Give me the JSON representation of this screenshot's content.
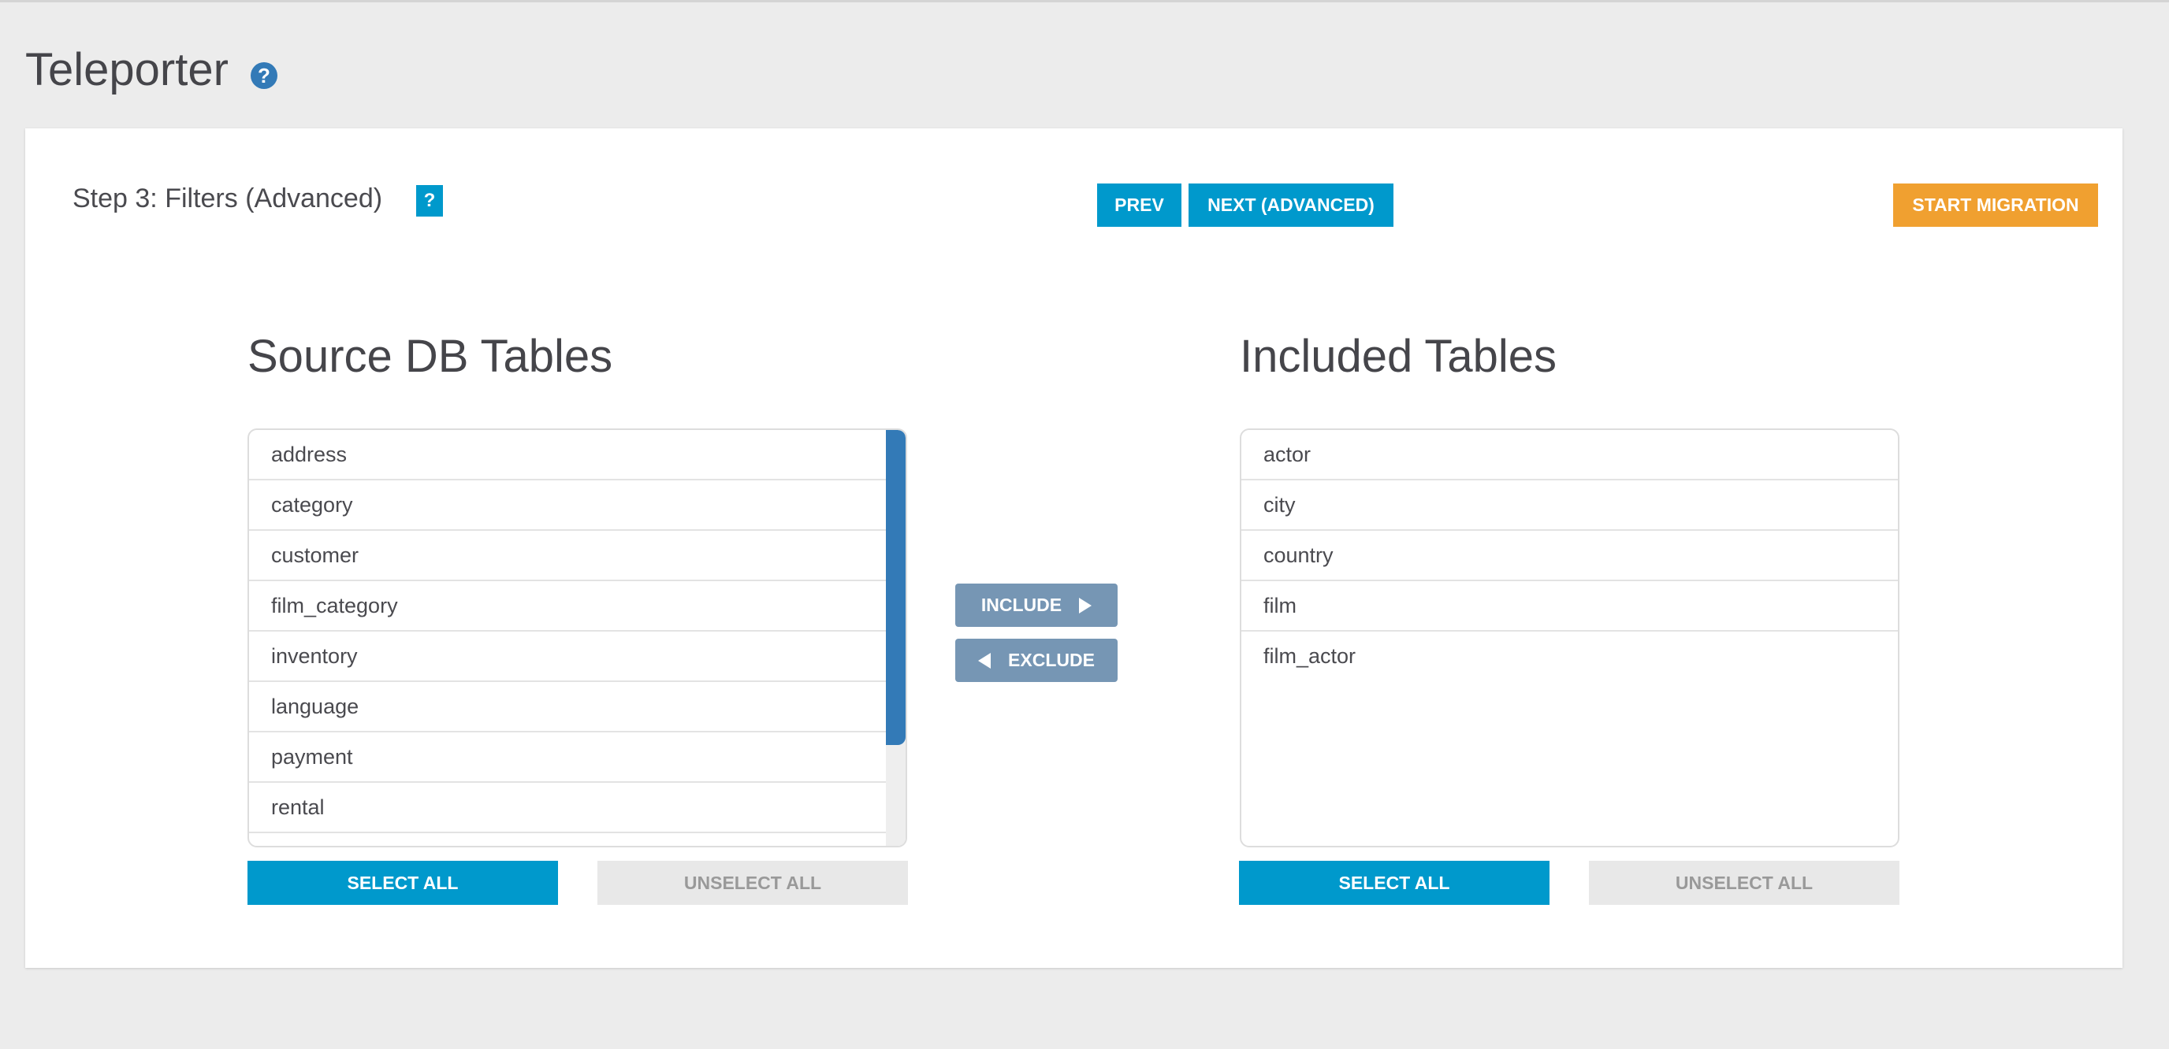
{
  "header": {
    "title": "Teleporter",
    "help": "?"
  },
  "step": {
    "label": "Step 3: Filters (Advanced)",
    "help": "?"
  },
  "toolbar": {
    "prev": "PREV",
    "next": "NEXT (ADVANCED)",
    "start": "START MIGRATION"
  },
  "source": {
    "title": "Source DB Tables",
    "items": [
      "address",
      "category",
      "customer",
      "film_category",
      "inventory",
      "language",
      "payment",
      "rental",
      ""
    ],
    "select_all": "SELECT ALL",
    "unselect_all": "UNSELECT ALL"
  },
  "transfer": {
    "include": "INCLUDE",
    "exclude": "EXCLUDE"
  },
  "included": {
    "title": "Included Tables",
    "items": [
      "actor",
      "city",
      "country",
      "film",
      "film_actor"
    ],
    "select_all": "SELECT ALL",
    "unselect_all": "UNSELECT ALL"
  },
  "colors": {
    "primary": "#0099cc",
    "accent": "#f0a030",
    "transfer": "#7696b4",
    "scrollbar": "#337ab7"
  }
}
